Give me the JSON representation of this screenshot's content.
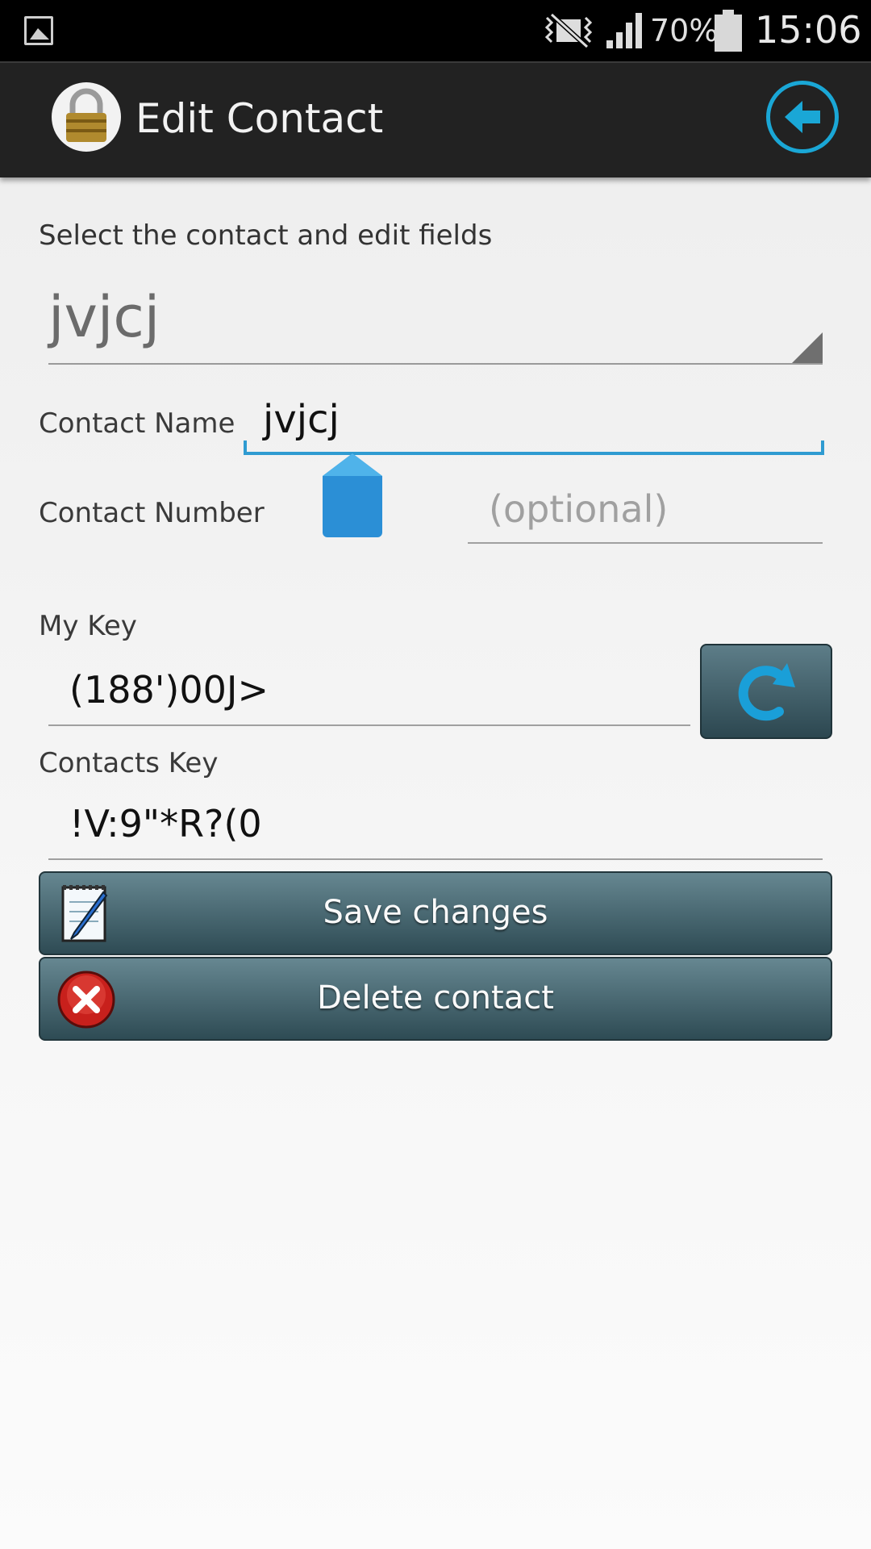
{
  "status_bar": {
    "battery_percent": "70%",
    "time": "15:06",
    "icons": [
      "gallery-icon",
      "mute-icon",
      "signal-icon",
      "battery-icon"
    ]
  },
  "action_bar": {
    "title": "Edit Contact",
    "logo_icon": "padlock-icon",
    "back_icon": "back-arrow-icon"
  },
  "form": {
    "instruction": "Select the contact and edit fields",
    "selected_contact": "jvjcj",
    "contact_name_label": "Contact Name",
    "contact_name_value": "jvjcj",
    "contact_number_label": "Contact Number",
    "contact_number_placeholder": "(optional)",
    "my_key_label": "My Key",
    "my_key_value": "(188')00J>",
    "contacts_key_label": "Contacts Key",
    "contacts_key_value": "!V:9\"*R?(0"
  },
  "buttons": {
    "save_label": "Save changes",
    "delete_label": "Delete contact",
    "refresh_icon": "refresh-icon"
  },
  "colors": {
    "accent": "#2f9bd1",
    "action_bar": "#222222",
    "button": "#3f5f69"
  }
}
